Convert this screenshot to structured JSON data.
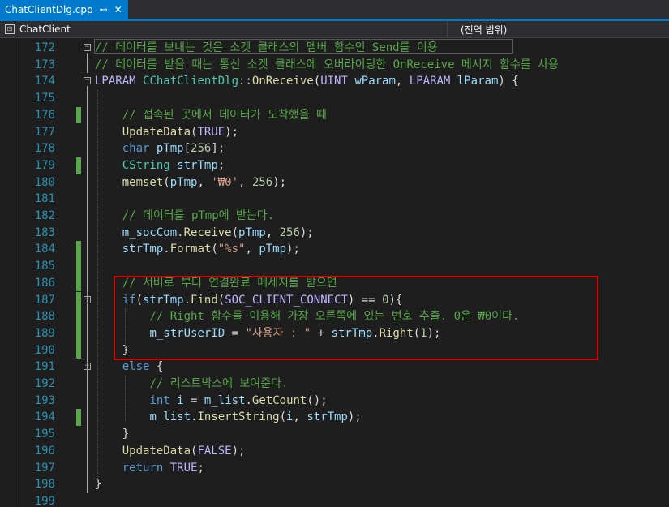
{
  "tab": {
    "filename": "ChatClientDlg.cpp",
    "pin_icon": "pin-icon",
    "close_icon": "close-icon"
  },
  "nav": {
    "class_scope": "ChatClient",
    "member_scope": "(전역 범위)"
  },
  "lines": [
    {
      "num": "172",
      "segs": [
        {
          "c": "c",
          "t": "// 데이터를 보내는 것은 소켓 클래스의 멤버 함수인 Send를 이용"
        }
      ]
    },
    {
      "num": "173",
      "segs": [
        {
          "c": "c",
          "t": "// 데이터를 받을 때는 통신 소켓 클래스에 오버라이딩한 OnReceive 메시지 함수를 사용"
        }
      ]
    },
    {
      "num": "174",
      "segs": [
        {
          "c": "m",
          "t": "LPARAM"
        },
        {
          "c": "",
          "t": " "
        },
        {
          "c": "t",
          "t": "CChatClientDlg"
        },
        {
          "c": "",
          "t": "::"
        },
        {
          "c": "f",
          "t": "OnReceive"
        },
        {
          "c": "",
          "t": "("
        },
        {
          "c": "m",
          "t": "UINT"
        },
        {
          "c": "",
          "t": " "
        },
        {
          "c": "v",
          "t": "wParam"
        },
        {
          "c": "",
          "t": ", "
        },
        {
          "c": "m",
          "t": "LPARAM"
        },
        {
          "c": "",
          "t": " "
        },
        {
          "c": "v",
          "t": "lParam"
        },
        {
          "c": "",
          "t": ") {"
        }
      ]
    },
    {
      "num": "175",
      "segs": []
    },
    {
      "num": "176",
      "segs": [
        {
          "c": "",
          "t": "    "
        },
        {
          "c": "c",
          "t": "// 접속된 곳에서 데이터가 도착했을 때"
        }
      ]
    },
    {
      "num": "177",
      "segs": [
        {
          "c": "",
          "t": "    "
        },
        {
          "c": "f",
          "t": "UpdateData"
        },
        {
          "c": "",
          "t": "("
        },
        {
          "c": "m",
          "t": "TRUE"
        },
        {
          "c": "",
          "t": ");"
        }
      ]
    },
    {
      "num": "178",
      "segs": [
        {
          "c": "",
          "t": "    "
        },
        {
          "c": "k",
          "t": "char"
        },
        {
          "c": "",
          "t": " "
        },
        {
          "c": "v",
          "t": "pTmp"
        },
        {
          "c": "",
          "t": "["
        },
        {
          "c": "n",
          "t": "256"
        },
        {
          "c": "",
          "t": "];"
        }
      ]
    },
    {
      "num": "179",
      "segs": [
        {
          "c": "",
          "t": "    "
        },
        {
          "c": "t",
          "t": "CString"
        },
        {
          "c": "",
          "t": " "
        },
        {
          "c": "v",
          "t": "strTmp"
        },
        {
          "c": "",
          "t": ";"
        }
      ]
    },
    {
      "num": "180",
      "segs": [
        {
          "c": "",
          "t": "    "
        },
        {
          "c": "f",
          "t": "memset"
        },
        {
          "c": "",
          "t": "("
        },
        {
          "c": "v",
          "t": "pTmp"
        },
        {
          "c": "",
          "t": ", "
        },
        {
          "c": "s",
          "t": "'₩0'"
        },
        {
          "c": "",
          "t": ", "
        },
        {
          "c": "n",
          "t": "256"
        },
        {
          "c": "",
          "t": ");"
        }
      ]
    },
    {
      "num": "181",
      "segs": []
    },
    {
      "num": "182",
      "segs": [
        {
          "c": "",
          "t": "    "
        },
        {
          "c": "c",
          "t": "// 데이터를 pTmp에 받는다."
        }
      ]
    },
    {
      "num": "183",
      "segs": [
        {
          "c": "",
          "t": "    "
        },
        {
          "c": "v",
          "t": "m_socCom"
        },
        {
          "c": "",
          "t": "."
        },
        {
          "c": "f",
          "t": "Receive"
        },
        {
          "c": "",
          "t": "("
        },
        {
          "c": "v",
          "t": "pTmp"
        },
        {
          "c": "",
          "t": ", "
        },
        {
          "c": "n",
          "t": "256"
        },
        {
          "c": "",
          "t": ");"
        }
      ]
    },
    {
      "num": "184",
      "segs": [
        {
          "c": "",
          "t": "    "
        },
        {
          "c": "v",
          "t": "strTmp"
        },
        {
          "c": "",
          "t": "."
        },
        {
          "c": "f",
          "t": "Format"
        },
        {
          "c": "",
          "t": "("
        },
        {
          "c": "s",
          "t": "\"%s\""
        },
        {
          "c": "",
          "t": ", "
        },
        {
          "c": "v",
          "t": "pTmp"
        },
        {
          "c": "",
          "t": ");"
        }
      ]
    },
    {
      "num": "185",
      "segs": []
    },
    {
      "num": "186",
      "segs": [
        {
          "c": "",
          "t": "    "
        },
        {
          "c": "c",
          "t": "// 서버로 부터 연결완료 메세지를 받으면"
        }
      ]
    },
    {
      "num": "187",
      "segs": [
        {
          "c": "",
          "t": "    "
        },
        {
          "c": "k",
          "t": "if"
        },
        {
          "c": "",
          "t": "("
        },
        {
          "c": "v",
          "t": "strTmp"
        },
        {
          "c": "",
          "t": "."
        },
        {
          "c": "f",
          "t": "Find"
        },
        {
          "c": "",
          "t": "("
        },
        {
          "c": "m",
          "t": "SOC_CLIENT_CONNECT"
        },
        {
          "c": "",
          "t": ") == "
        },
        {
          "c": "n",
          "t": "0"
        },
        {
          "c": "",
          "t": "){"
        }
      ]
    },
    {
      "num": "188",
      "segs": [
        {
          "c": "",
          "t": "        "
        },
        {
          "c": "c",
          "t": "// Right 함수를 이용해 가장 오른쪽에 있는 번호 추출. 0은 ₩0이다."
        }
      ]
    },
    {
      "num": "189",
      "segs": [
        {
          "c": "",
          "t": "        "
        },
        {
          "c": "v",
          "t": "m_strUserID"
        },
        {
          "c": "",
          "t": " = "
        },
        {
          "c": "s",
          "t": "\"사용자 : \""
        },
        {
          "c": "",
          "t": " + "
        },
        {
          "c": "v",
          "t": "strTmp"
        },
        {
          "c": "",
          "t": "."
        },
        {
          "c": "f",
          "t": "Right"
        },
        {
          "c": "",
          "t": "("
        },
        {
          "c": "n",
          "t": "1"
        },
        {
          "c": "",
          "t": ");"
        }
      ]
    },
    {
      "num": "190",
      "segs": [
        {
          "c": "",
          "t": "    }"
        }
      ]
    },
    {
      "num": "191",
      "segs": [
        {
          "c": "",
          "t": "    "
        },
        {
          "c": "k",
          "t": "else"
        },
        {
          "c": "",
          "t": " {"
        }
      ]
    },
    {
      "num": "192",
      "segs": [
        {
          "c": "",
          "t": "        "
        },
        {
          "c": "c",
          "t": "// 리스트박스에 보여준다."
        }
      ]
    },
    {
      "num": "193",
      "segs": [
        {
          "c": "",
          "t": "        "
        },
        {
          "c": "k",
          "t": "int"
        },
        {
          "c": "",
          "t": " "
        },
        {
          "c": "v",
          "t": "i"
        },
        {
          "c": "",
          "t": " = "
        },
        {
          "c": "v",
          "t": "m_list"
        },
        {
          "c": "",
          "t": "."
        },
        {
          "c": "f",
          "t": "GetCount"
        },
        {
          "c": "",
          "t": "();"
        }
      ]
    },
    {
      "num": "194",
      "segs": [
        {
          "c": "",
          "t": "        "
        },
        {
          "c": "v",
          "t": "m_list"
        },
        {
          "c": "",
          "t": "."
        },
        {
          "c": "f",
          "t": "InsertString"
        },
        {
          "c": "",
          "t": "("
        },
        {
          "c": "v",
          "t": "i"
        },
        {
          "c": "",
          "t": ", "
        },
        {
          "c": "v",
          "t": "strTmp"
        },
        {
          "c": "",
          "t": ");"
        }
      ]
    },
    {
      "num": "195",
      "segs": [
        {
          "c": "",
          "t": "    }"
        }
      ]
    },
    {
      "num": "196",
      "segs": [
        {
          "c": "",
          "t": "    "
        },
        {
          "c": "f",
          "t": "UpdateData"
        },
        {
          "c": "",
          "t": "("
        },
        {
          "c": "m",
          "t": "FALSE"
        },
        {
          "c": "",
          "t": ");"
        }
      ]
    },
    {
      "num": "197",
      "segs": [
        {
          "c": "",
          "t": "    "
        },
        {
          "c": "k",
          "t": "return"
        },
        {
          "c": "",
          "t": " "
        },
        {
          "c": "m",
          "t": "TRUE"
        },
        {
          "c": "",
          "t": ";"
        }
      ]
    },
    {
      "num": "198",
      "segs": [
        {
          "c": "",
          "t": "}"
        }
      ]
    },
    {
      "num": "199",
      "segs": []
    }
  ],
  "changed_lines": [
    "176",
    "179",
    "184",
    "185",
    "186",
    "187",
    "188",
    "189",
    "190",
    "194"
  ],
  "fold_markers": [
    "172",
    "174",
    "187",
    "191"
  ],
  "colors": {
    "accent": "#007acc",
    "highlight_box": "#e00000",
    "comment": "#57a64a",
    "keyword": "#569cd6"
  }
}
